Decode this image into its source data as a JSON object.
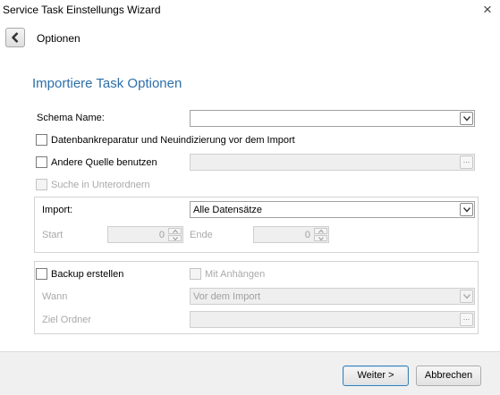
{
  "window": {
    "title": "Service Task Einstellungs Wizard",
    "close_glyph": "×"
  },
  "nav": {
    "back_icon": "chevron-left-icon",
    "title": "Optionen"
  },
  "section": {
    "title": "Importiere Task Optionen"
  },
  "schema": {
    "label": "Schema Name:",
    "value": ""
  },
  "options": {
    "repair_label": "Datenbankreparatur und Neuindizierung vor dem Import",
    "repair_checked": false,
    "other_source_label": "Andere Quelle benutzen",
    "other_source_checked": false,
    "other_source_path": "",
    "subfolders_label": "Suche in Unterordnern",
    "subfolders_checked": false,
    "ellipsis": "..."
  },
  "import": {
    "label": "Import:",
    "value": "Alle Datensätze",
    "start_label": "Start",
    "start_value": "0",
    "end_label": "Ende",
    "end_value": "0"
  },
  "backup": {
    "label": "Backup erstellen",
    "checked": false,
    "attachments_label": "Mit Anhängen",
    "attachments_checked": false,
    "when_label": "Wann",
    "when_value": "Vor dem Import",
    "target_label": "Ziel Ordner",
    "target_value": ""
  },
  "footer": {
    "next_label": "Weiter >",
    "cancel_label": "Abbrechen"
  },
  "colors": {
    "accent": "#2d6fa8",
    "disabled_text": "#a9a9a9",
    "primary_border": "#3c7fb1"
  }
}
